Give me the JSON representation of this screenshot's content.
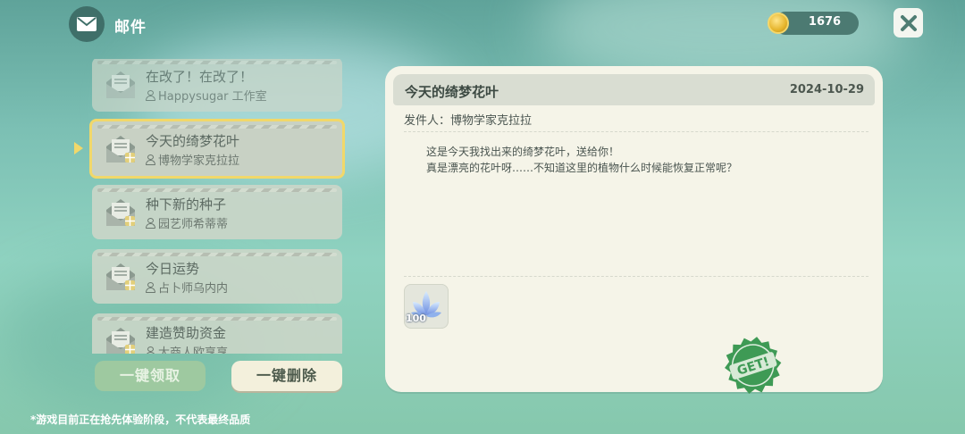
{
  "header": {
    "title": "邮件",
    "mail_icon": "envelope-icon"
  },
  "currency": {
    "icon": "gold-coin-icon",
    "value": "1676"
  },
  "close_icon": "close-x-icon",
  "mail_list": [
    {
      "title": "在改了！在改了！",
      "sender": "Happysugar 工作室",
      "selected": false
    },
    {
      "title": "今天的绮梦花叶",
      "sender": "博物学家克拉拉",
      "selected": true
    },
    {
      "title": "种下新的种子",
      "sender": "园艺师希蒂蒂",
      "selected": false
    },
    {
      "title": "今日运势",
      "sender": "占卜师乌内内",
      "selected": false
    },
    {
      "title": "建造赞助资金",
      "sender": "大商人欧享享",
      "selected": false
    }
  ],
  "buttons": {
    "claim_all": "一键领取",
    "delete_all": "一键删除"
  },
  "detail": {
    "title": "今天的绮梦花叶",
    "date": "2024-10-29",
    "sender_line": "发件人：博物学家克拉拉",
    "body": "这是今天我找出来的绮梦花叶，送给你！\n真是漂亮的花叶呀……不知道这里的植物什么时候能恢复正常呢？",
    "reward": {
      "icon": "dream-leaf-icon",
      "count": "100"
    },
    "get_stamp": "GET!"
  },
  "disclaimer": "*游戏目前正在抢先体验阶段，不代表最终品质",
  "colors": {
    "selected_border": "#f1d86a",
    "panel_bg": "#f5f4e8",
    "stamp_green": "#3e9a55"
  }
}
